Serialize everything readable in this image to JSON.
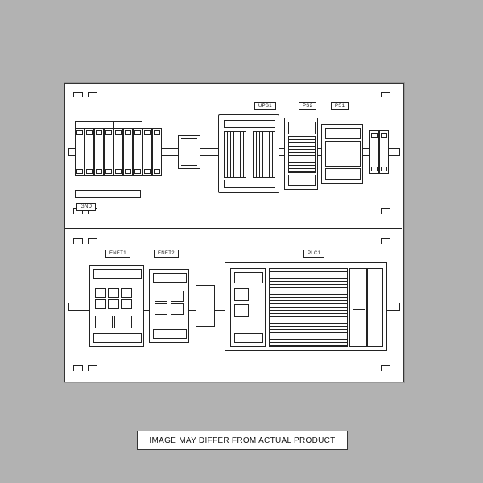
{
  "caption": "IMAGE MAY DIFFER FROM ACTUAL PRODUCT",
  "labels": {
    "gnd": "GND",
    "ups1": "UPS1",
    "ps2": "PS2",
    "ps1": "PS1",
    "enet1": "ENET1",
    "enet2": "ENET2",
    "plc1": "PLC1"
  },
  "colors": {
    "page_bg": "#b2b2b2",
    "paper": "#ffffff",
    "line": "#222222"
  }
}
